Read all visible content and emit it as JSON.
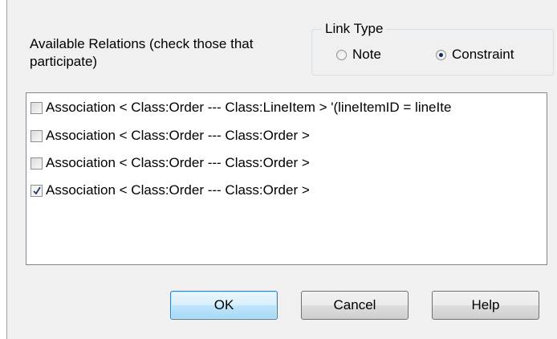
{
  "relations_label": "Available Relations (check those that participate)",
  "link_type": {
    "legend": "Link Type",
    "options": [
      {
        "label": "Note",
        "checked": false
      },
      {
        "label": "Constraint",
        "checked": true
      }
    ]
  },
  "relations": [
    {
      "label": "Association < Class:Order --- Class:LineItem > '(lineItemID = lineIte",
      "checked": false
    },
    {
      "label": "Association < Class:Order --- Class:Order >",
      "checked": false
    },
    {
      "label": "Association < Class:Order --- Class:Order >",
      "checked": false
    },
    {
      "label": "Association < Class:Order --- Class:Order >",
      "checked": true
    }
  ],
  "buttons": {
    "ok": "OK",
    "cancel": "Cancel",
    "help": "Help"
  },
  "colors": {
    "dialog_background": "#f0f0f0",
    "default_button_border": "#3c7fb1",
    "radio_dot": "#0c2f63"
  }
}
